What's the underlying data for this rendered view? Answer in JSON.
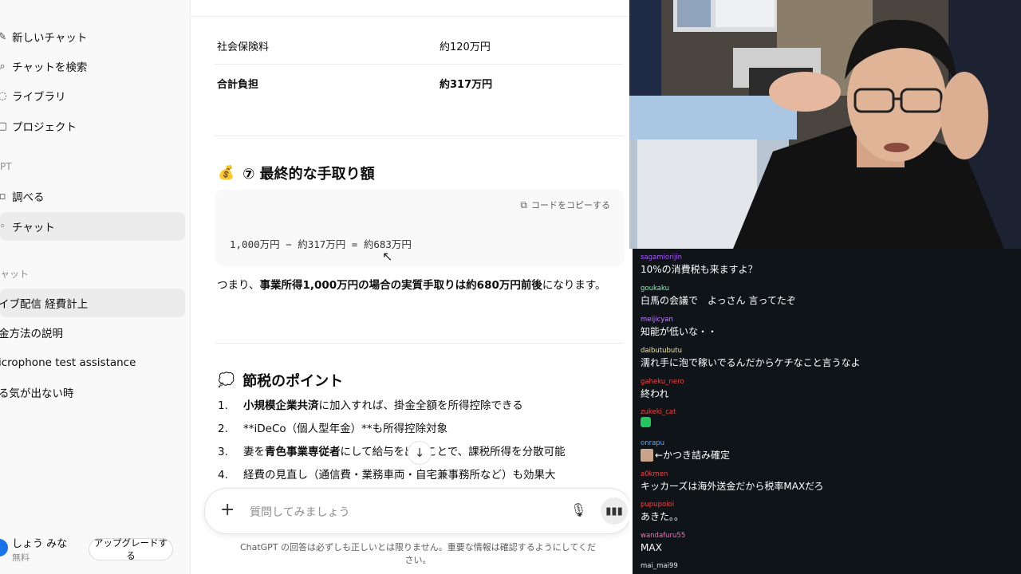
{
  "sidebar": {
    "items": [
      {
        "label": "新しいチャット",
        "icon": "new-chat-icon"
      },
      {
        "label": "チャットを検索",
        "icon": "search-icon"
      },
      {
        "label": "ライブラリ",
        "icon": "library-icon"
      },
      {
        "label": "プロジェクト",
        "icon": "project-icon"
      }
    ],
    "section_gpt": "PT",
    "gpt_items": [
      {
        "label": "調べる",
        "icon": "explore-icon"
      },
      {
        "label": "チャット",
        "icon": "chat-icon"
      }
    ],
    "section_chats": "ャット",
    "chats": [
      "イブ配信 経費計上",
      "金方法の説明",
      "icrophone test assistance",
      "る気が出ない時"
    ],
    "user": {
      "name": "しょう みな",
      "plan": "無料"
    },
    "upgrade_label": "アップグレードする"
  },
  "main": {
    "table_rows": [
      {
        "label": "社会保険料",
        "value": "約120万円"
      },
      {
        "label": "合計負担",
        "value": "約317万円"
      }
    ],
    "section7": {
      "emoji": "💰",
      "title": "⑦ 最終的な手取り額"
    },
    "code": {
      "copy_label": "コードをコピーする",
      "text": "1,000万円 − 約317万円 = 約683万円"
    },
    "summary": {
      "prefix": "つまり、",
      "bold1": "事業所得1,000万円の場合の実質手取りは約680万円前後",
      "suffix": "になります。"
    },
    "tips": {
      "emoji": "💭",
      "title": "節税のポイント",
      "items": [
        {
          "num": "1.",
          "bold": "小規模企業共済",
          "text": "に加入すれば、掛金全額を所得控除できる"
        },
        {
          "num": "2.",
          "bold": "",
          "text": "**iDeCo（個人型年金）**も所得控除対象"
        },
        {
          "num": "3.",
          "bold": "青色事業専従者",
          "text": "にして給与を出すことで、課税所得を分散可能",
          "prefix": "妻を"
        },
        {
          "num": "4.",
          "bold": "",
          "text": "経費の見直し（通信費・業務車両・自宅兼事務所など）も効果大"
        }
      ]
    },
    "composer": {
      "placeholder": "質問してみましょう"
    },
    "disclaimer": "ChatGPT の回答は必ずしも正しいとは限りません。重要な情報は確認するようにしてください。"
  },
  "stream_chat": [
    {
      "user": "sagamiorijin",
      "text": "10%の消費税も来ますよ？",
      "color": "#a855f7"
    },
    {
      "user": "goukaku",
      "text": "白馬の会議で　よっさん 言ってたぞ",
      "color": "#86efac"
    },
    {
      "user": "meijicyan",
      "text": "知能が低いな・・",
      "color": "#c084fc"
    },
    {
      "user": "daibutubutu",
      "text": "濡れ手に泡で稼いでるんだからケチなこと言うなよ",
      "color": "#fde68a"
    },
    {
      "user": "gaheku_nero",
      "text": "終われ",
      "color": "#ef4444"
    },
    {
      "user": "zukeki_cat",
      "text": "",
      "color": "#ef4444",
      "emote": "green"
    },
    {
      "user": "onrapu",
      "text": "←かつき詰み確定",
      "color": "#60a5fa",
      "emote": "face"
    },
    {
      "user": "a0kmen",
      "text": "キッカーズは海外送金だから税率MAXだろ",
      "color": "#ef4444"
    },
    {
      "user": "pupupoioi",
      "text": "あきた。。",
      "color": "#ef4444"
    },
    {
      "user": "wandafuru55",
      "text": "MAX",
      "color": "#f472b6"
    },
    {
      "user": "mai_mai99",
      "text": "",
      "color": "#e5e7eb"
    }
  ]
}
